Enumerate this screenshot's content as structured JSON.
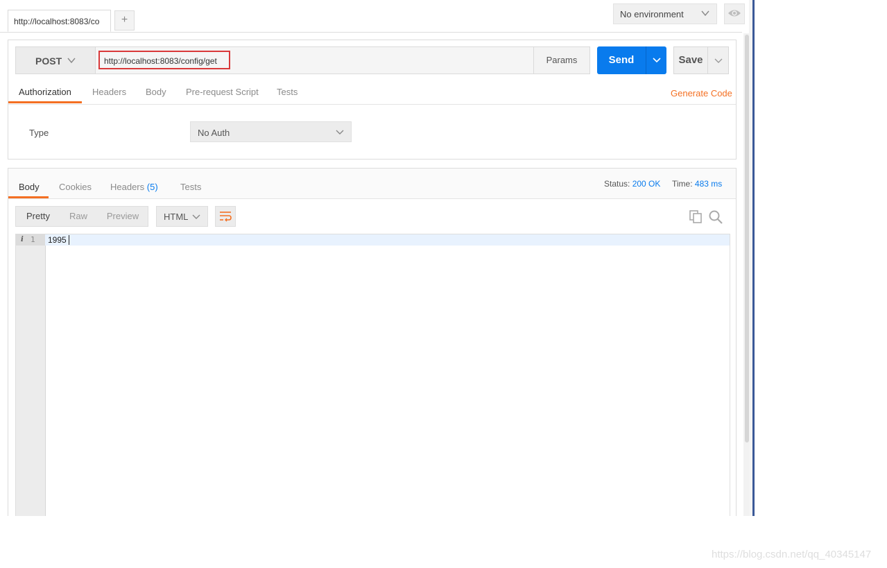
{
  "tabs": {
    "active_tab_label": "http://localhost:8083/co",
    "add_tab_label": "+"
  },
  "environment": {
    "selected": "No environment"
  },
  "request": {
    "method": "POST",
    "url": "http://localhost:8083/config/get",
    "params_label": "Params",
    "send_label": "Send",
    "save_label": "Save",
    "tabs": [
      "Authorization",
      "Headers",
      "Body",
      "Pre-request Script",
      "Tests"
    ],
    "active_tab": "Authorization",
    "generate_code_label": "Generate Code",
    "auth": {
      "type_label": "Type",
      "type_value": "No Auth"
    }
  },
  "response": {
    "tabs": {
      "body": "Body",
      "cookies": "Cookies",
      "headers": "Headers",
      "headers_count": "(5)",
      "tests": "Tests"
    },
    "status_label": "Status:",
    "status_value": "200 OK",
    "time_label": "Time:",
    "time_value": "483 ms",
    "view_modes": [
      "Pretty",
      "Raw",
      "Preview"
    ],
    "active_view": "Pretty",
    "format": "HTML",
    "body_lines": [
      {
        "number": "1",
        "text": "1995"
      }
    ]
  },
  "watermark": "https://blog.csdn.net/qq_40345147",
  "colors": {
    "accent_orange": "#f47023",
    "send_blue": "#097bed",
    "highlight_red": "#d9393a"
  }
}
